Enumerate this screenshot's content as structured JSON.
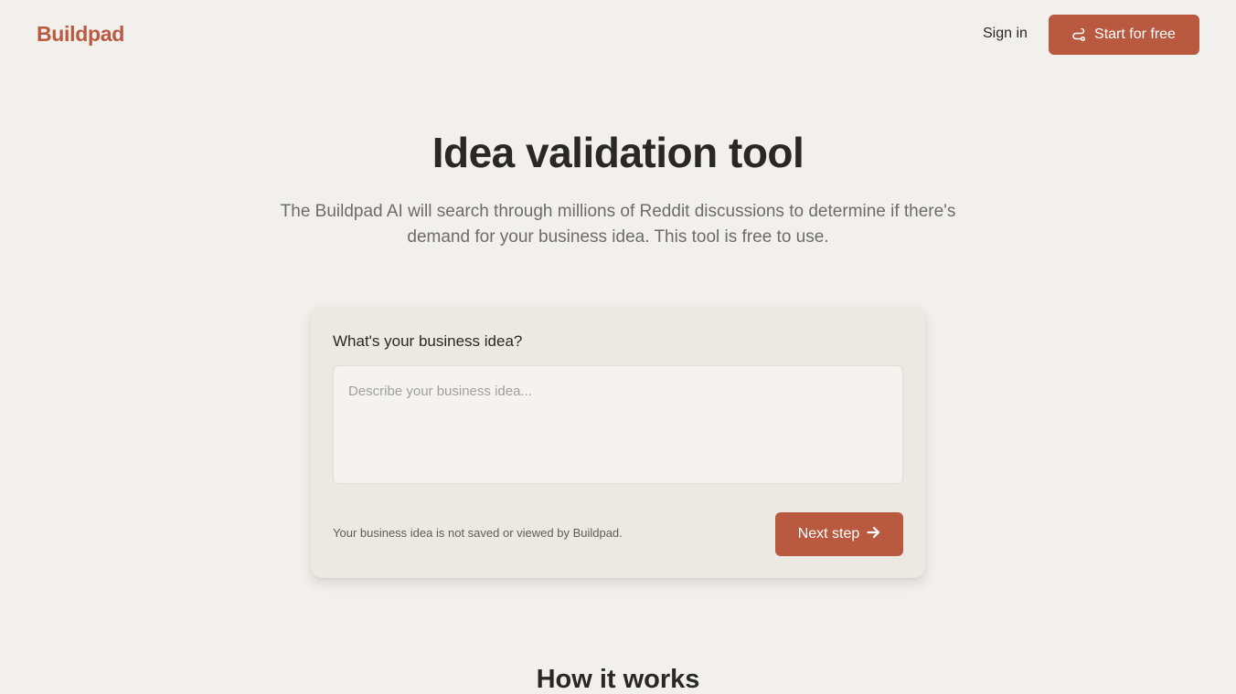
{
  "header": {
    "logo": "Buildpad",
    "signin_label": "Sign in",
    "start_label": "Start for free",
    "start_icon": "route-icon"
  },
  "hero": {
    "title": "Idea validation tool",
    "subtitle": "The Buildpad AI will search through millions of Reddit discussions to determine if there's demand for your business idea. This tool is free to use."
  },
  "form": {
    "label": "What's your business idea?",
    "input_value": "",
    "input_placeholder": "Describe your business idea...",
    "privacy_note": "Your business idea is not saved or viewed by Buildpad.",
    "next_label": "Next step",
    "next_icon": "arrow-right-icon"
  },
  "section": {
    "how_title": "How it works"
  },
  "colors": {
    "accent": "#b95a40",
    "background": "#f2f0ec",
    "card": "#ece8e2"
  }
}
